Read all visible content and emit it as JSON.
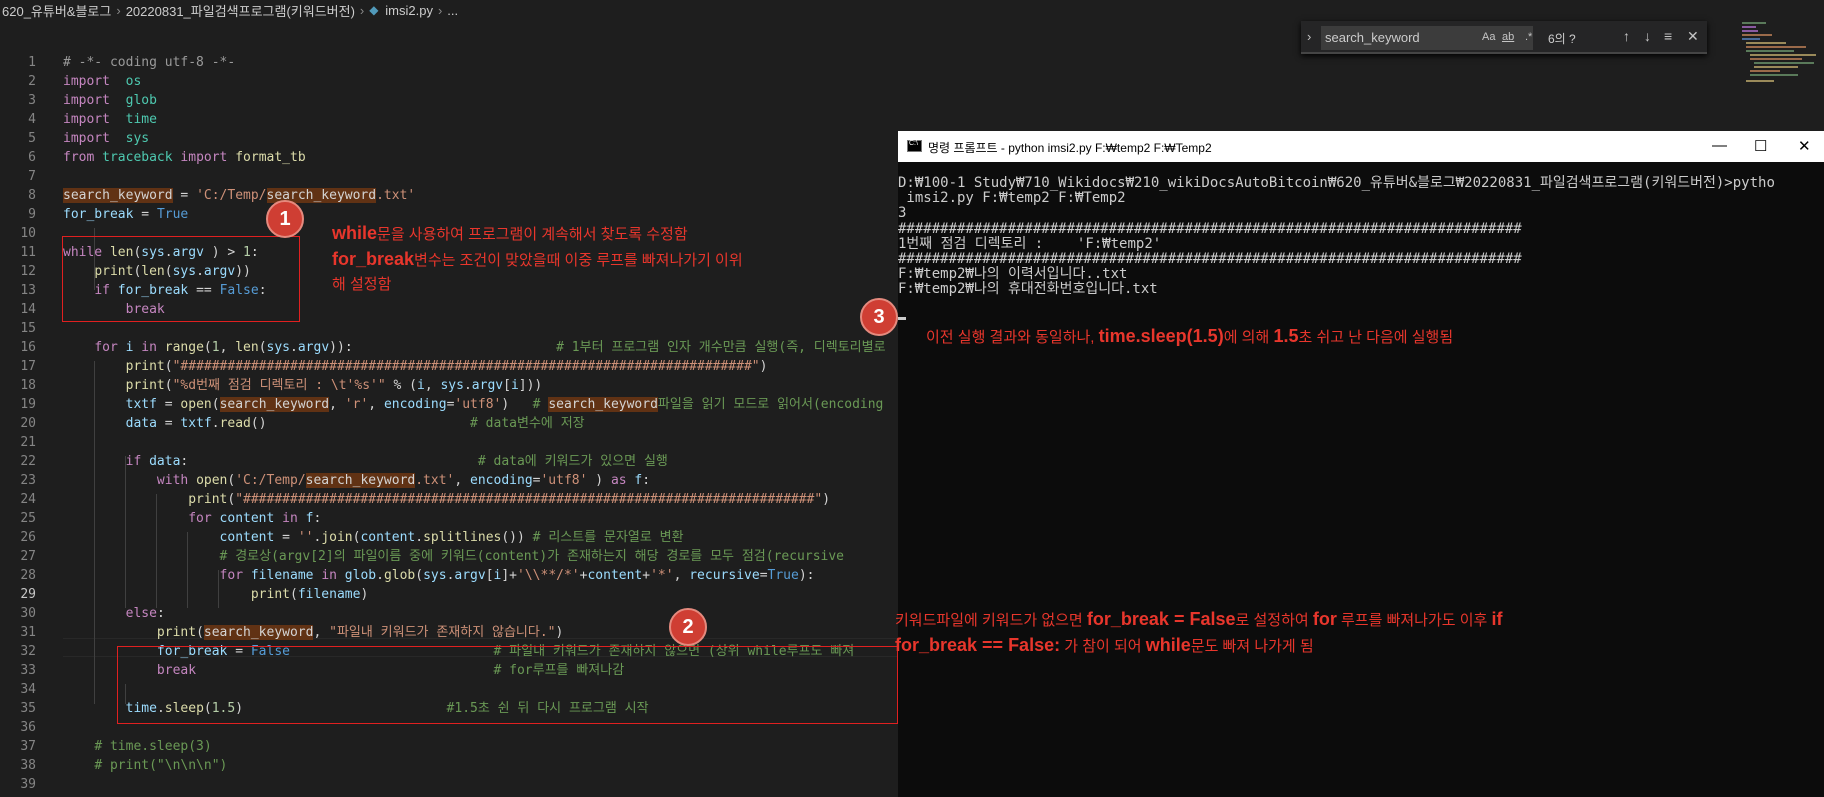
{
  "breadcrumb": {
    "parts": [
      "620_유튜버&블로그",
      "20220831_파일검색프로그램(키워드버전)",
      "imsi2.py",
      "..."
    ],
    "file_icon": "python-file-icon"
  },
  "find_widget": {
    "query": "search_keyword",
    "match_case": "Aa",
    "whole_word": "ab",
    "regex": ".*",
    "result_count": "6의 ?",
    "icons": [
      "arrow-up-icon",
      "arrow-down-icon",
      "selection-icon",
      "close-icon"
    ]
  },
  "editor": {
    "active_line": 29,
    "lines": [
      [
        [
          "cmk",
          "# -*- coding utf-8 -*-"
        ]
      ],
      [
        [
          "kw",
          "import"
        ],
        [
          "",
          "  "
        ],
        [
          "tp",
          "os"
        ]
      ],
      [
        [
          "kw",
          "import"
        ],
        [
          "",
          "  "
        ],
        [
          "tp",
          "glob"
        ]
      ],
      [
        [
          "kw",
          "import"
        ],
        [
          "",
          "  "
        ],
        [
          "tp",
          "time"
        ]
      ],
      [
        [
          "kw",
          "import"
        ],
        [
          "",
          "  "
        ],
        [
          "tp",
          "sys"
        ]
      ],
      [
        [
          "kw",
          "from"
        ],
        [
          "",
          " "
        ],
        [
          "tp",
          "traceback"
        ],
        [
          "",
          " "
        ],
        [
          "kw",
          "import"
        ],
        [
          "",
          " "
        ],
        [
          "fn",
          "format_tb"
        ]
      ],
      [],
      [
        [
          "hl",
          "search_keyword"
        ],
        [
          "",
          " = "
        ],
        [
          "st",
          "'C:/Temp/"
        ],
        [
          "hl",
          "search_keyword"
        ],
        [
          "st",
          ".txt'"
        ]
      ],
      [
        [
          "vr",
          "for_break"
        ],
        [
          "",
          " = "
        ],
        [
          "kb",
          "True"
        ]
      ],
      [],
      [
        [
          "kw",
          "while"
        ],
        [
          "",
          " "
        ],
        [
          "fn",
          "len"
        ],
        [
          "",
          "("
        ],
        [
          "vr",
          "sys"
        ],
        [
          "",
          "."
        ],
        [
          "vr",
          "argv"
        ],
        [
          "",
          " ) > "
        ],
        [
          "nm",
          "1"
        ],
        [
          "",
          ":"
        ]
      ],
      [
        [
          "",
          "    "
        ],
        [
          "fn",
          "print"
        ],
        [
          "",
          "("
        ],
        [
          "fn",
          "len"
        ],
        [
          "",
          "("
        ],
        [
          "vr",
          "sys"
        ],
        [
          "",
          "."
        ],
        [
          "vr",
          "argv"
        ],
        [
          "",
          "))"
        ]
      ],
      [
        [
          "",
          "    "
        ],
        [
          "kw",
          "if"
        ],
        [
          "",
          " "
        ],
        [
          "vr",
          "for_break"
        ],
        [
          "",
          " == "
        ],
        [
          "kb",
          "False"
        ],
        [
          "",
          ":"
        ]
      ],
      [
        [
          "",
          "        "
        ],
        [
          "kw",
          "break"
        ]
      ],
      [],
      [
        [
          "",
          "    "
        ],
        [
          "kw",
          "for"
        ],
        [
          "",
          " "
        ],
        [
          "vr",
          "i"
        ],
        [
          "",
          " "
        ],
        [
          "kw",
          "in"
        ],
        [
          "",
          " "
        ],
        [
          "fn",
          "range"
        ],
        [
          "",
          "("
        ],
        [
          "nm",
          "1"
        ],
        [
          "",
          ", "
        ],
        [
          "fn",
          "len"
        ],
        [
          "",
          "("
        ],
        [
          "vr",
          "sys"
        ],
        [
          "",
          "."
        ],
        [
          "vr",
          "argv"
        ],
        [
          "",
          "))"
        ],
        [
          "",
          ":"
        ],
        [
          "",
          "                          "
        ],
        [
          "cm",
          "# 1부터 프로그램 인자 개수만큼 실행(즉, 디렉토리별로"
        ]
      ],
      [
        [
          "",
          "        "
        ],
        [
          "fn",
          "print"
        ],
        [
          "",
          "("
        ],
        [
          "st",
          "\"#########################################################################\""
        ],
        [
          "",
          ")"
        ]
      ],
      [
        [
          "",
          "        "
        ],
        [
          "fn",
          "print"
        ],
        [
          "",
          "("
        ],
        [
          "st",
          "\"%d번째 점검 디렉토리 : \\t'%s'\""
        ],
        [
          "",
          " % ("
        ],
        [
          "vr",
          "i"
        ],
        [
          "",
          ", "
        ],
        [
          "vr",
          "sys"
        ],
        [
          "",
          "."
        ],
        [
          "vr",
          "argv"
        ],
        [
          "",
          "["
        ],
        [
          "vr",
          "i"
        ],
        [
          "",
          "]))"
        ]
      ],
      [
        [
          "",
          "        "
        ],
        [
          "vr",
          "txtf"
        ],
        [
          "",
          " = "
        ],
        [
          "fn",
          "open"
        ],
        [
          "",
          "("
        ],
        [
          "hl",
          "search_keyword"
        ],
        [
          "",
          ", "
        ],
        [
          "st",
          "'r'"
        ],
        [
          "",
          ", "
        ],
        [
          "vr",
          "encoding"
        ],
        [
          "",
          "="
        ],
        [
          "st",
          "'utf8'"
        ],
        [
          "",
          ")   "
        ],
        [
          "cm",
          "# "
        ],
        [
          "hl",
          "search_keyword"
        ],
        [
          "cm",
          "파일을 읽기 모드로 읽어서(encoding"
        ]
      ],
      [
        [
          "",
          "        "
        ],
        [
          "vr",
          "data"
        ],
        [
          "",
          " = "
        ],
        [
          "vr",
          "txtf"
        ],
        [
          "",
          "."
        ],
        [
          "fn",
          "read"
        ],
        [
          "",
          "()"
        ],
        [
          "",
          "                          "
        ],
        [
          "cm",
          "# data변수에 저장"
        ]
      ],
      [],
      [
        [
          "",
          "        "
        ],
        [
          "kw",
          "if"
        ],
        [
          "",
          " "
        ],
        [
          "vr",
          "data"
        ],
        [
          "",
          ":"
        ],
        [
          "",
          "                                     "
        ],
        [
          "cm",
          "# data에 키워드가 있으면 실행"
        ]
      ],
      [
        [
          "",
          "            "
        ],
        [
          "kw",
          "with"
        ],
        [
          "",
          " "
        ],
        [
          "fn",
          "open"
        ],
        [
          "",
          "("
        ],
        [
          "st",
          "'C:/Temp/"
        ],
        [
          "hl",
          "search_keyword"
        ],
        [
          "st",
          ".txt'"
        ],
        [
          "",
          ", "
        ],
        [
          "vr",
          "encoding"
        ],
        [
          "",
          "="
        ],
        [
          "st",
          "'utf8'"
        ],
        [
          "",
          " ) "
        ],
        [
          "kw",
          "as"
        ],
        [
          "",
          " "
        ],
        [
          "vr",
          "f"
        ],
        [
          "",
          ":"
        ]
      ],
      [
        [
          "",
          "                "
        ],
        [
          "fn",
          "print"
        ],
        [
          "",
          "("
        ],
        [
          "st",
          "\"#########################################################################\""
        ],
        [
          "",
          ")"
        ]
      ],
      [
        [
          "",
          "                "
        ],
        [
          "kw",
          "for"
        ],
        [
          "",
          " "
        ],
        [
          "vr",
          "content"
        ],
        [
          "",
          " "
        ],
        [
          "kw",
          "in"
        ],
        [
          "",
          " "
        ],
        [
          "vr",
          "f"
        ],
        [
          "",
          ":"
        ]
      ],
      [
        [
          "",
          "                    "
        ],
        [
          "vr",
          "content"
        ],
        [
          "",
          " = "
        ],
        [
          "st",
          "''"
        ],
        [
          "",
          "."
        ],
        [
          "fn",
          "join"
        ],
        [
          "",
          "("
        ],
        [
          "vr",
          "content"
        ],
        [
          "",
          "."
        ],
        [
          "fn",
          "splitlines"
        ],
        [
          "",
          "()) "
        ],
        [
          "cm",
          "# 리스트를 문자열로 변환"
        ]
      ],
      [
        [
          "",
          "                    "
        ],
        [
          "cm",
          "# 경로상(argv[2]의 파일이름 중에 키워드(content)가 존재하는지 해당 경로를 모두 점검(recursive"
        ]
      ],
      [
        [
          "",
          "                    "
        ],
        [
          "kw",
          "for"
        ],
        [
          "",
          " "
        ],
        [
          "vr",
          "filename"
        ],
        [
          "",
          " "
        ],
        [
          "kw",
          "in"
        ],
        [
          "",
          " "
        ],
        [
          "vr",
          "glob"
        ],
        [
          "",
          "."
        ],
        [
          "fn",
          "glob"
        ],
        [
          "",
          "("
        ],
        [
          "vr",
          "sys"
        ],
        [
          "",
          "."
        ],
        [
          "vr",
          "argv"
        ],
        [
          "",
          "["
        ],
        [
          "vr",
          "i"
        ],
        [
          "",
          "]+"
        ],
        [
          "st",
          "'\\\\**/*'"
        ],
        [
          "",
          "+"
        ],
        [
          "vr",
          "content"
        ],
        [
          "",
          "+"
        ],
        [
          "st",
          "'*'"
        ],
        [
          "",
          ", "
        ],
        [
          "vr",
          "recursive"
        ],
        [
          "",
          "="
        ],
        [
          "kb",
          "True"
        ],
        [
          "",
          "):"
        ]
      ],
      [
        [
          "",
          "                        "
        ],
        [
          "fn",
          "print"
        ],
        [
          "",
          "("
        ],
        [
          "vr",
          "filename"
        ],
        [
          "",
          ")"
        ]
      ],
      [
        [
          "",
          "        "
        ],
        [
          "kw",
          "else"
        ],
        [
          "",
          ":"
        ]
      ],
      [
        [
          "",
          "            "
        ],
        [
          "fn",
          "print"
        ],
        [
          "",
          "("
        ],
        [
          "hl",
          "search_keyword"
        ],
        [
          "",
          ", "
        ],
        [
          "st",
          "\"파일내 키워드가 존재하지 않습니다.\""
        ],
        [
          "",
          ")"
        ]
      ],
      [
        [
          "",
          "            "
        ],
        [
          "vr",
          "for_break"
        ],
        [
          "",
          " = "
        ],
        [
          "kb",
          "False"
        ],
        [
          "",
          "                          "
        ],
        [
          "cm",
          "# 파일내 키워드가 존재하지 않으면 (상위 while루프도 빠져"
        ]
      ],
      [
        [
          "",
          "            "
        ],
        [
          "kw",
          "break"
        ],
        [
          "",
          "                                      "
        ],
        [
          "cm",
          "# for루프를 빠져나감"
        ]
      ],
      [],
      [
        [
          "",
          "        "
        ],
        [
          "vr",
          "time"
        ],
        [
          "",
          "."
        ],
        [
          "fn",
          "sleep"
        ],
        [
          "",
          "("
        ],
        [
          "nm",
          "1.5"
        ],
        [
          "",
          ")"
        ],
        [
          "",
          "                          "
        ],
        [
          "cm",
          "#1.5초 쉰 뒤 다시 프로그램 시작"
        ]
      ],
      [],
      [
        [
          "",
          "    "
        ],
        [
          "cm",
          "# time.sleep(3)"
        ]
      ],
      [
        [
          "",
          "    "
        ],
        [
          "cm",
          "# print(\"\\n\\n\\n\")"
        ]
      ],
      []
    ]
  },
  "console": {
    "title": "명령 프롬프트 - python  imsi2.py F:₩temp2 F:₩Temp2",
    "window_buttons": [
      "minimize-icon",
      "maximize-icon",
      "close-icon"
    ],
    "output_lines": [
      "D:₩100-1 Study₩710_Wikidocs₩210_wikiDocsAutoBitcoin₩620_유튜버&블로그₩20220831_파일검색프로그램(키워드버전)>pytho",
      " imsi2.py F:₩temp2 F:₩Temp2",
      "3",
      "##########################################################################",
      "1번째 점검 디렉토리 :    'F:₩temp2'",
      "##########################################################################",
      "F:₩temp2₩나의 이력서입니다..txt",
      "F:₩temp2₩나의 휴대전화번호입니다.txt"
    ]
  },
  "annotations": {
    "badge1": "1",
    "badge2": "2",
    "badge3": "3",
    "note1": {
      "line1_strong": "while",
      "line1_rest": "문을 사용하여 프로그램이 계속해서 찾도록 수정함",
      "line2_strong": "for_break",
      "line2_rest": "변수는 조건이 맞았을때 이중 루프를 빠져나가기 이위",
      "line3": "해 설정함"
    },
    "note3": {
      "a": "이전 실행 결과와 동일하나, ",
      "b": "time.sleep(1.5)",
      "c": "에 의해 ",
      "d": "1.5",
      "e": "초 쉬고 난 다음에 실행됨"
    },
    "note2": {
      "a": "키워드파일에 키워드가 없으면 ",
      "b": "for_break = False",
      "c": "로 설정하여 ",
      "d": "for",
      "e": " 루프를 빠져나가도 이후 ",
      "f": "if",
      "g": "for_break == False:",
      "h": " 가 참이 되어 ",
      "i": "while",
      "j": "문도 빠져 나가게 됨"
    },
    "accent_color": "#e8362c"
  }
}
